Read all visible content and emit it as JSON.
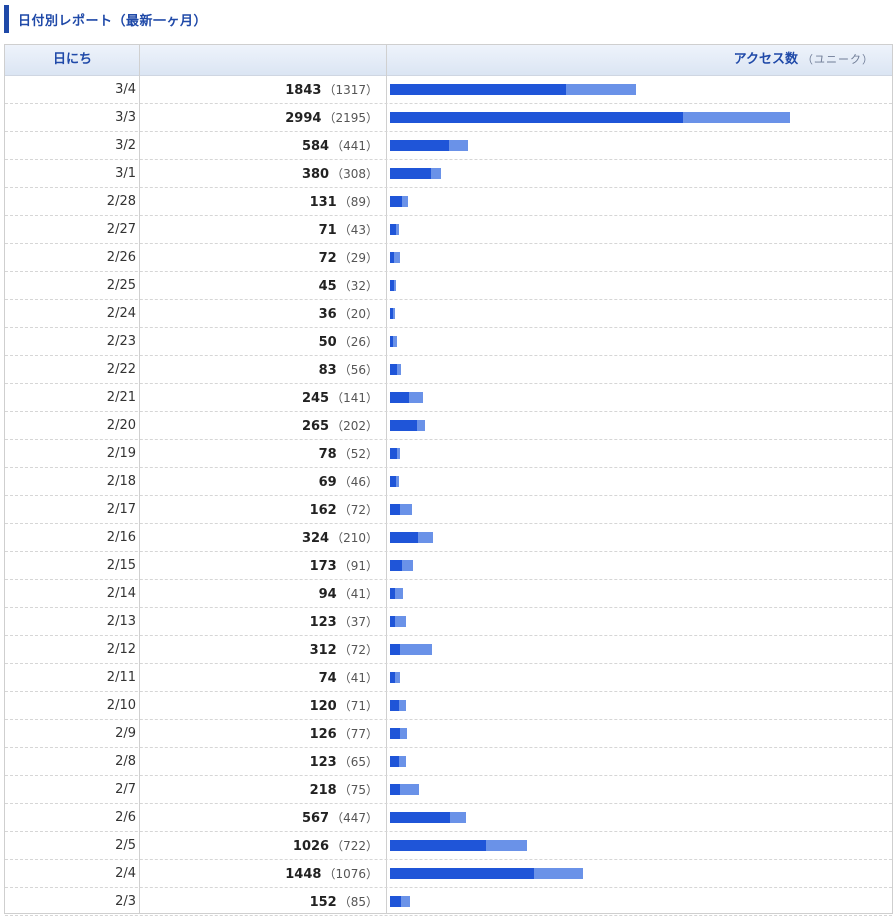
{
  "title": "日付別レポート（最新一ヶ月）",
  "header": {
    "date_label": "日にち",
    "access_label": "アクセス数",
    "unique_label": "（ユニーク）"
  },
  "colors": {
    "accent": "#1f49a8",
    "bar_total": "#6a92e8",
    "bar_unique": "#1f55d8"
  },
  "chart_data": {
    "type": "bar",
    "orientation": "horizontal",
    "categories": [
      "3/4",
      "3/3",
      "3/2",
      "3/1",
      "2/28",
      "2/27",
      "2/26",
      "2/25",
      "2/24",
      "2/23",
      "2/22",
      "2/21",
      "2/20",
      "2/19",
      "2/18",
      "2/17",
      "2/16",
      "2/15",
      "2/14",
      "2/13",
      "2/12",
      "2/11",
      "2/10",
      "2/9",
      "2/8",
      "2/7",
      "2/6",
      "2/5",
      "2/4",
      "2/3"
    ],
    "series": [
      {
        "name": "アクセス数",
        "values": [
          1843,
          2994,
          584,
          380,
          131,
          71,
          72,
          45,
          36,
          50,
          83,
          245,
          265,
          78,
          69,
          162,
          324,
          173,
          94,
          123,
          312,
          74,
          120,
          126,
          123,
          218,
          567,
          1026,
          1448,
          152
        ]
      },
      {
        "name": "ユニーク",
        "values": [
          1317,
          2195,
          441,
          308,
          89,
          43,
          29,
          32,
          20,
          26,
          56,
          141,
          202,
          52,
          46,
          72,
          210,
          91,
          41,
          37,
          72,
          41,
          71,
          77,
          65,
          75,
          447,
          722,
          1076,
          85
        ]
      }
    ],
    "max": 2994
  }
}
